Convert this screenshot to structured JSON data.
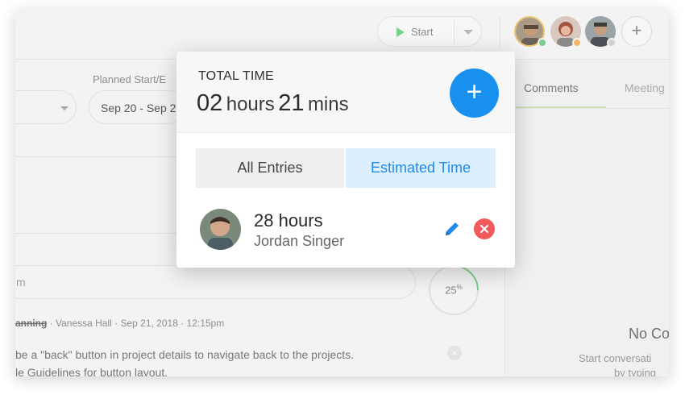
{
  "toolbar": {
    "start_label": "Start"
  },
  "header_fields": {
    "planned_label": "Planned Start/E",
    "planned_value": "Sep 20 - Sep 2"
  },
  "right_panel": {
    "tabs": [
      "Comments",
      "Meeting"
    ],
    "empty_title": "No Co",
    "empty_line1": "Start conversati",
    "empty_line2": "by typing"
  },
  "progress": {
    "value": "25",
    "unit": "%",
    "fraction": 0.25
  },
  "comment_input": {
    "placeholder": "m"
  },
  "activity": {
    "title": "anning",
    "meta": " · Vanessa Hall · Sep 21, 2018 · 12:15pm",
    "line1": "be a \"back\" button in project details to navigate back to the projects.",
    "line2": "le Guidelines for button layout."
  },
  "popup": {
    "title": "TOTAL TIME",
    "hours_num": "02",
    "hours_unit": "hours",
    "mins_num": "21",
    "mins_unit": "mins",
    "tabs": {
      "all": "All Entries",
      "estimated": "Estimated Time"
    },
    "entry": {
      "hours": "28 hours",
      "name": "Jordan Singer"
    }
  },
  "colors": {
    "accent": "#1890ee",
    "estimated_tab_bg": "#dcefff",
    "delete": "#f15b5b",
    "online": "#7ccf8c",
    "away": "#f3b66a"
  },
  "icons": [
    "play-icon",
    "chevron-down-icon",
    "plus-icon",
    "pencil-icon",
    "close-icon"
  ]
}
